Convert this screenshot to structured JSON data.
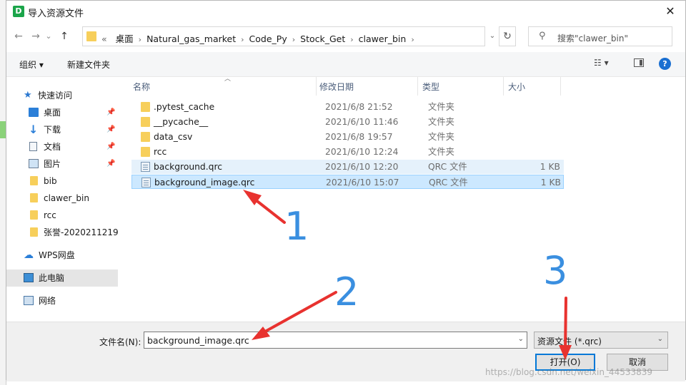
{
  "window": {
    "title": "导入资源文件",
    "app_icon_letter": "D",
    "close_glyph": "✕"
  },
  "nav": {
    "back": "←",
    "forward": "→",
    "up_menu": "⌄",
    "up": "↑",
    "breadcrumb": [
      "«",
      "桌面",
      "Natural_gas_market",
      "Code_Py",
      "Stock_Get",
      "clawer_bin"
    ],
    "sep": "›",
    "dropdown": "⌄",
    "refresh": "↻",
    "search_placeholder": "搜索\"clawer_bin\""
  },
  "toolbar": {
    "organize": "组织 ▾",
    "new_folder": "新建文件夹",
    "view_glyph": "☷ ▾",
    "help": "?"
  },
  "sidebar": {
    "items": [
      {
        "label": "快速访问",
        "icon": "star-icon"
      },
      {
        "label": "桌面",
        "icon": "desktop-icon",
        "pinned": true
      },
      {
        "label": "下载",
        "icon": "download-icon",
        "pinned": true
      },
      {
        "label": "文档",
        "icon": "document-icon",
        "pinned": true
      },
      {
        "label": "图片",
        "icon": "pictures-icon",
        "pinned": true
      },
      {
        "label": "bib",
        "icon": "folder-icon"
      },
      {
        "label": "clawer_bin",
        "icon": "folder-icon"
      },
      {
        "label": "rcc",
        "icon": "folder-icon"
      },
      {
        "label": "张誉-2020211219-",
        "icon": "folder-icon"
      },
      {
        "label": "WPS网盘",
        "icon": "cloud-icon"
      },
      {
        "label": "此电脑",
        "icon": "computer-icon",
        "selected": true
      },
      {
        "label": "网络",
        "icon": "network-icon"
      }
    ],
    "pin_glyph": "📌"
  },
  "columns": {
    "name": "名称",
    "date": "修改日期",
    "type": "类型",
    "size": "大小"
  },
  "files": [
    {
      "name": ".pytest_cache",
      "date": "2021/6/8 21:52",
      "type": "文件夹",
      "size": "",
      "kind": "folder"
    },
    {
      "name": "__pycache__",
      "date": "2021/6/10 11:46",
      "type": "文件夹",
      "size": "",
      "kind": "folder"
    },
    {
      "name": "data_csv",
      "date": "2021/6/8 19:57",
      "type": "文件夹",
      "size": "",
      "kind": "folder"
    },
    {
      "name": "rcc",
      "date": "2021/6/10 12:24",
      "type": "文件夹",
      "size": "",
      "kind": "folder"
    },
    {
      "name": "background.qrc",
      "date": "2021/6/10 12:20",
      "type": "QRC 文件",
      "size": "1 KB",
      "kind": "qrc",
      "state": "hover"
    },
    {
      "name": "background_image.qrc",
      "date": "2021/6/10 15:07",
      "type": "QRC 文件",
      "size": "1 KB",
      "kind": "qrc",
      "state": "selected"
    }
  ],
  "bottom": {
    "filename_label": "文件名(N):",
    "filename_value": "background_image.qrc",
    "filetype_value": "资源文件 (*.qrc)",
    "open_label": "打开(O)",
    "cancel_label": "取消",
    "watermark": "https://blog.csdn.net/weixin_44533839"
  },
  "annotations": {
    "n1": "1",
    "n2": "2",
    "n3": "3",
    "arrow_color": "#e8322f",
    "number_color": "#3a8fe0"
  }
}
